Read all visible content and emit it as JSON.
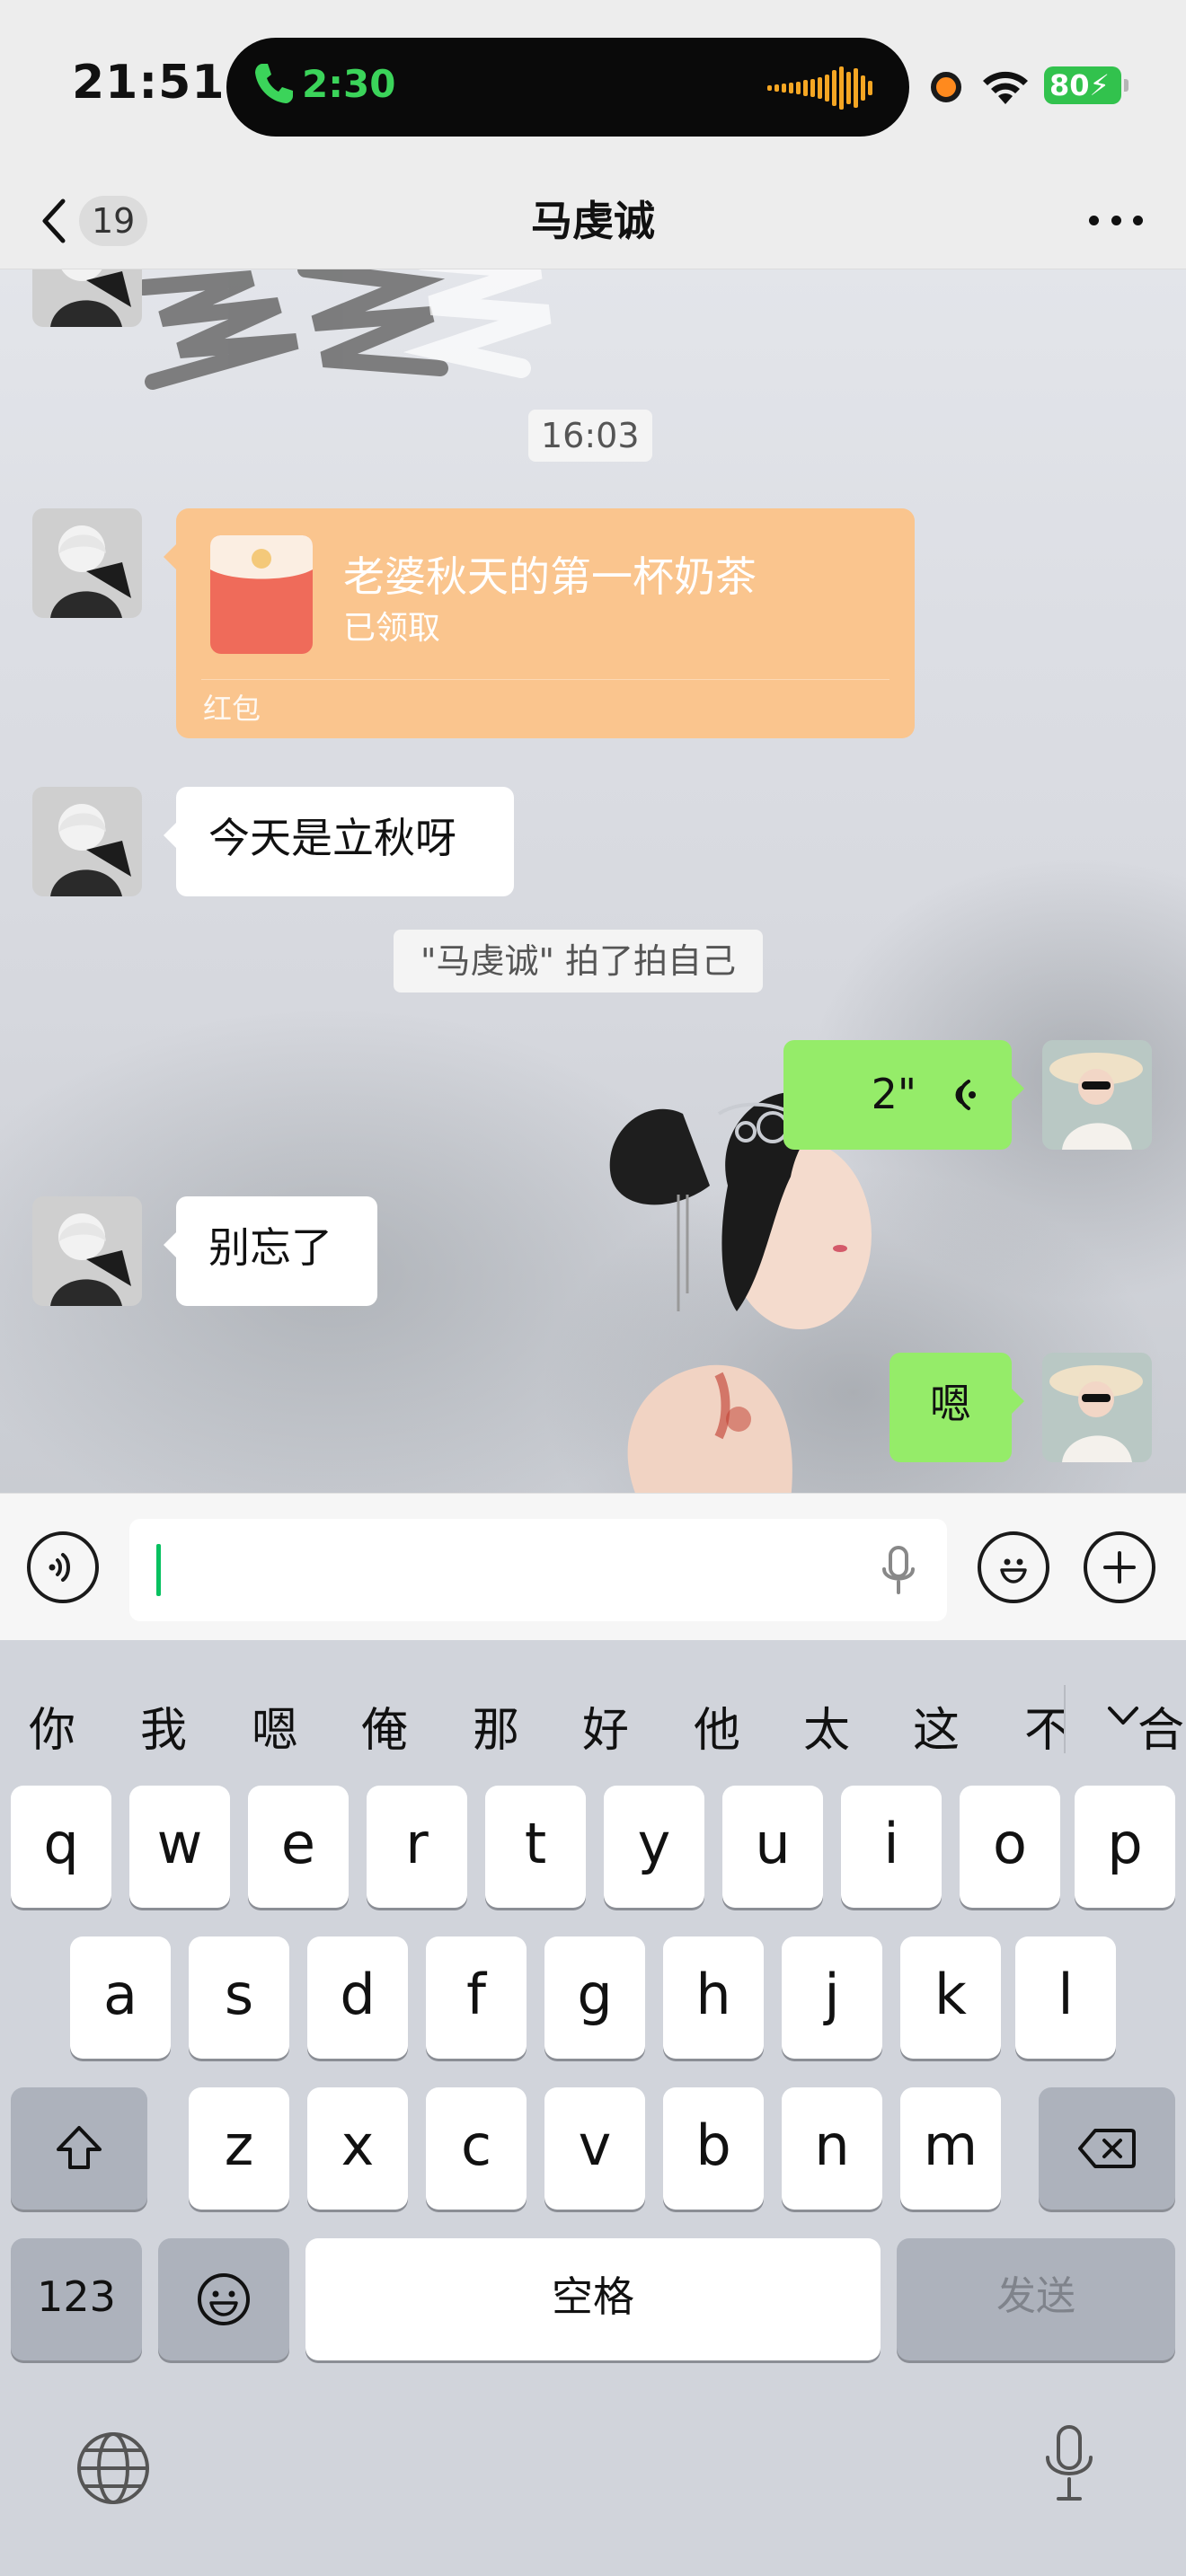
{
  "status_bar": {
    "time": "21:51",
    "call_timer": "2:30",
    "battery": "80"
  },
  "nav": {
    "back_count": "19",
    "title": "马虔诚"
  },
  "messages": {
    "timestamp": "16:03",
    "red_packet": {
      "title": "老婆秋天的第一杯奶茶",
      "status": "已领取",
      "label": "红包"
    },
    "msg_lqiu": "今天是立秋呀",
    "pat_notice": "\"马虔诚\" 拍了拍自己",
    "voice_duration": "2\"",
    "msg_biewang": "别忘了",
    "msg_en": "嗯"
  },
  "input": {
    "value": ""
  },
  "keyboard": {
    "candidates": [
      "你",
      "我",
      "嗯",
      "俺",
      "那",
      "好",
      "他",
      "太",
      "这",
      "不"
    ],
    "candidate_overflow": "合",
    "row1": [
      "q",
      "w",
      "e",
      "r",
      "t",
      "y",
      "u",
      "i",
      "o",
      "p"
    ],
    "row2": [
      "a",
      "s",
      "d",
      "f",
      "g",
      "h",
      "j",
      "k",
      "l"
    ],
    "row3": [
      "z",
      "x",
      "c",
      "v",
      "b",
      "n",
      "m"
    ],
    "numbers_key": "123",
    "space_key": "空格",
    "send_key": "发送"
  },
  "colors": {
    "sent_bubble": "#95ec69",
    "received_bubble": "#ffffff",
    "red_packet": "#fac58e",
    "accent_green": "#07c160",
    "keyboard_bg": "#d1d4db"
  },
  "icons": {
    "back": "chevron-left-icon",
    "more": "more-dots-icon",
    "voice_mode": "voice-wave-icon",
    "emoji": "emoji-icon",
    "plus": "plus-icon",
    "mic": "mic-icon",
    "shift": "shift-icon",
    "delete": "backspace-icon",
    "globe": "globe-icon"
  }
}
